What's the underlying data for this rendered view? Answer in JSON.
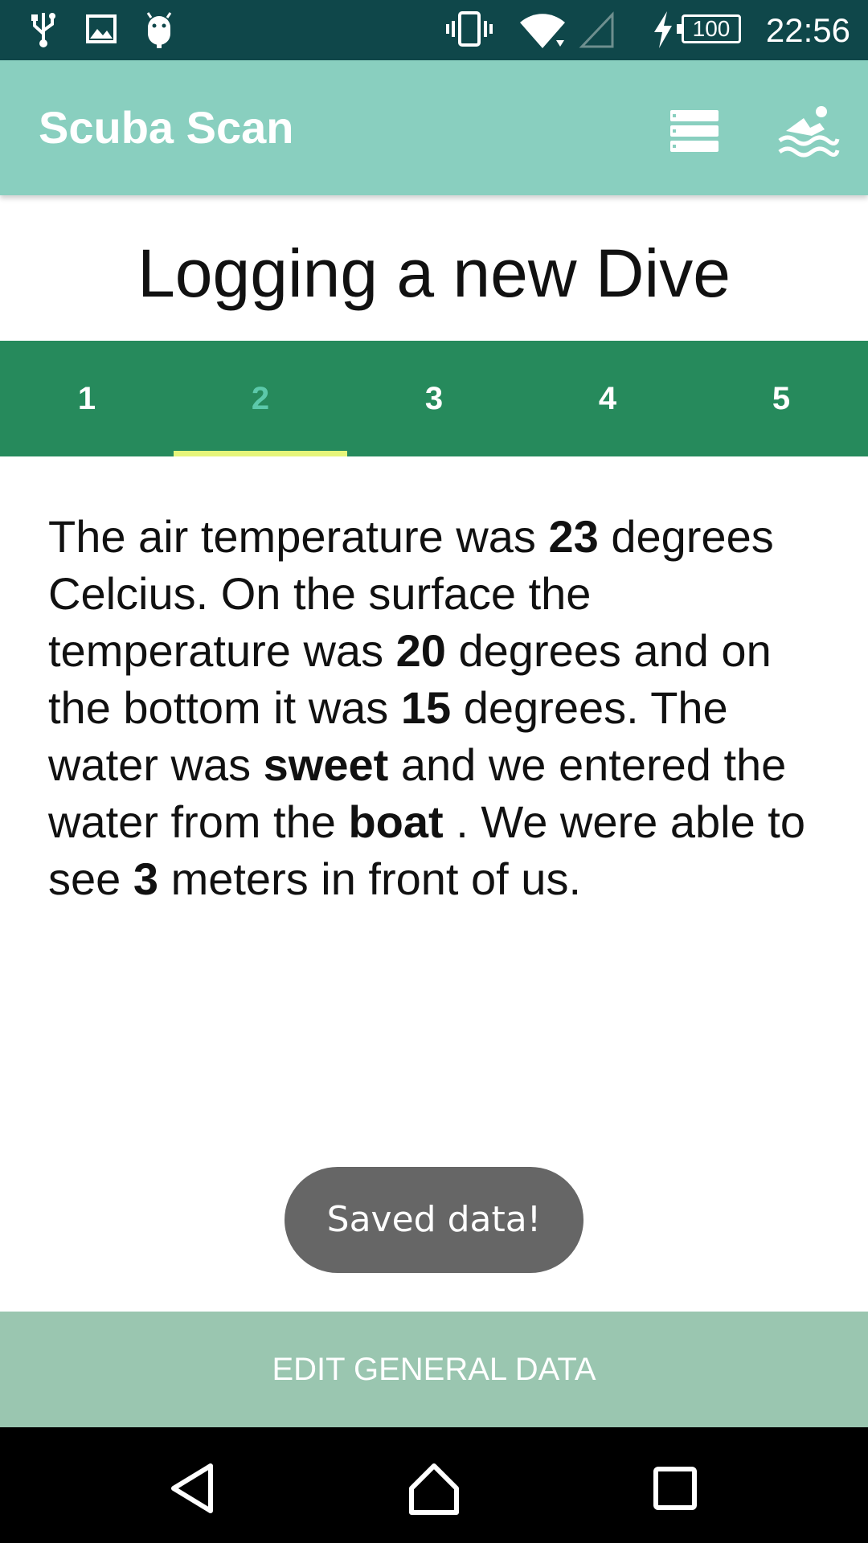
{
  "status_bar": {
    "time": "22:56",
    "battery_level": "100",
    "icons": [
      "usb-icon",
      "image-icon",
      "android-icon",
      "vibrate-icon",
      "wifi-icon",
      "signal-icon",
      "charging-icon",
      "battery-icon"
    ]
  },
  "app_bar": {
    "title": "Scuba Scan",
    "actions": [
      "list-icon",
      "swimmer-icon"
    ]
  },
  "page": {
    "title": "Logging a new Dive"
  },
  "tabs": [
    {
      "label": "1",
      "active": false
    },
    {
      "label": "2",
      "active": true
    },
    {
      "label": "3",
      "active": false
    },
    {
      "label": "4",
      "active": false
    },
    {
      "label": "5",
      "active": false
    }
  ],
  "summary": {
    "t1": "The air temperature was ",
    "air_temp": "23",
    "t2": " degrees Celcius. On the surface the temperature was ",
    "surface_temp": "20",
    "t3": " degrees and on the bottom it was ",
    "bottom_temp": "15",
    "t4": " degrees. The water was ",
    "water_type": "sweet",
    "t5": " and we entered the water from the ",
    "entry": "boat",
    "t6": " . We were able to see ",
    "visibility": "3",
    "t7": " meters in front of us."
  },
  "toast": "Saved data!",
  "bottom_button": "EDIT GENERAL DATA",
  "nav": [
    "back-icon",
    "home-icon",
    "recents-icon"
  ],
  "colors": {
    "status_bar": "#0f474a",
    "app_bar": "#89cfbf",
    "tabs": "#268a5c",
    "tab_active": "#5cc9aa",
    "tab_indicator": "#e6f57a",
    "bottom_button": "#9ac6b0"
  }
}
